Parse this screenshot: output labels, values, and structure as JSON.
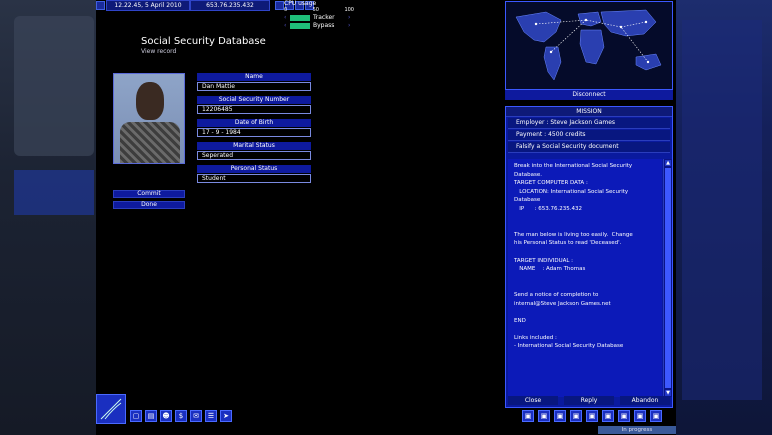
{
  "topbar": {
    "datetime": "12.22.45, 5 April 2010",
    "ip": "653.76.235.432"
  },
  "cpu": {
    "label": "CPU usage",
    "scale": [
      "0",
      "50",
      "100"
    ],
    "tasks": [
      {
        "name": "Tracker"
      },
      {
        "name": "Bypass"
      }
    ]
  },
  "record": {
    "title": "Social Security Database",
    "subtitle": "View record",
    "fields": [
      {
        "label": "Name",
        "value": "Dan Mattie"
      },
      {
        "label": "Social Security Number",
        "value": "12206485"
      },
      {
        "label": "Date of Birth",
        "value": "17 - 9 - 1984"
      },
      {
        "label": "Marital Status",
        "value": "Seperated"
      },
      {
        "label": "Personal Status",
        "value": "Student"
      }
    ],
    "commit_label": "Commit",
    "done_label": "Done"
  },
  "map": {
    "disconnect_label": "Disconnect"
  },
  "mission": {
    "header": "MISSION",
    "employer": "Employer : Steve Jackson Games",
    "payment": "Payment : 4500 credits",
    "task": "Falsify a Social Security document",
    "body": "Break into the International Social Security\nDatabase.\nTARGET COMPUTER DATA :\n   LOCATION: International Social Security\nDatabase\n   IP      : 653.76.235.432\n\n\nThe man below is living too easily.  Change\nhis Personal Status to read 'Deceased'.\n\nTARGET INDIVIDUAL :\n   NAME    : Adam Thomas\n\n\nSend a notice of completion to\ninternal@Steve Jackson Games.net\n\nEND\n\nLinks included :\n- International Social Security Database",
    "close_label": "Close",
    "reply_label": "Reply",
    "abandon_label": "Abandon"
  },
  "status": {
    "progress_label": "In progress"
  },
  "colors": {
    "panel_blue": "#0e1a9e",
    "accent_blue": "#3b58ff",
    "task_green": "#1fbf7a"
  }
}
